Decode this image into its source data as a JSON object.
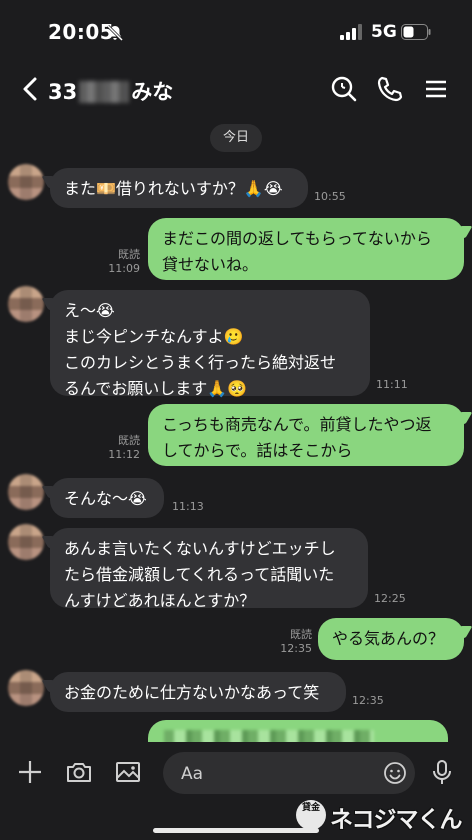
{
  "status": {
    "time": "20:05",
    "network": "5G"
  },
  "header": {
    "prefix": "33",
    "suffix": "みな"
  },
  "date_divider": "今日",
  "messages": [
    {
      "dir": "in",
      "text": "また💴借りれないすか？🙏😭",
      "time": "10:55"
    },
    {
      "dir": "out",
      "text": "まだこの間の返してもらってないから\n貸せないね。",
      "read": "既読",
      "time": "11:09"
    },
    {
      "dir": "in",
      "text": "え〜😭\nまじ今ピンチなんすよ🥲\nこのカレシとうまく行ったら絶対返せ\nるんでお願いします🙏🥺",
      "time": "11:11"
    },
    {
      "dir": "out",
      "text": "こっちも商売なんで。前貸したやつ返\nしてからで。話はそこから",
      "read": "既読",
      "time": "11:12"
    },
    {
      "dir": "in",
      "text": "そんな〜😭",
      "time": "11:13"
    },
    {
      "dir": "in",
      "text": "あんま言いたくないんすけどエッチし\nたら借金減額してくれるって話聞いた\nんすけどあれほんとすか？",
      "time": "12:25"
    },
    {
      "dir": "out",
      "text": "やる気あんの？",
      "read": "既読",
      "time": "12:35"
    },
    {
      "dir": "in",
      "text": "お金のために仕方ないかなあって笑",
      "time": "12:35"
    }
  ],
  "input": {
    "placeholder": "Aa"
  },
  "icons": {
    "back": "chevron-left-icon",
    "search": "search-icon",
    "call": "phone-icon",
    "menu": "menu-icon",
    "add": "plus-icon",
    "camera": "camera-icon",
    "image": "image-icon",
    "emoji": "emoji-icon",
    "mic": "mic-icon"
  },
  "watermark": {
    "badge": "貸金",
    "text": "ネコジマくん"
  },
  "colors": {
    "background": "#1c1c1e",
    "incoming": "#333336",
    "outgoing": "#8ad67f"
  }
}
